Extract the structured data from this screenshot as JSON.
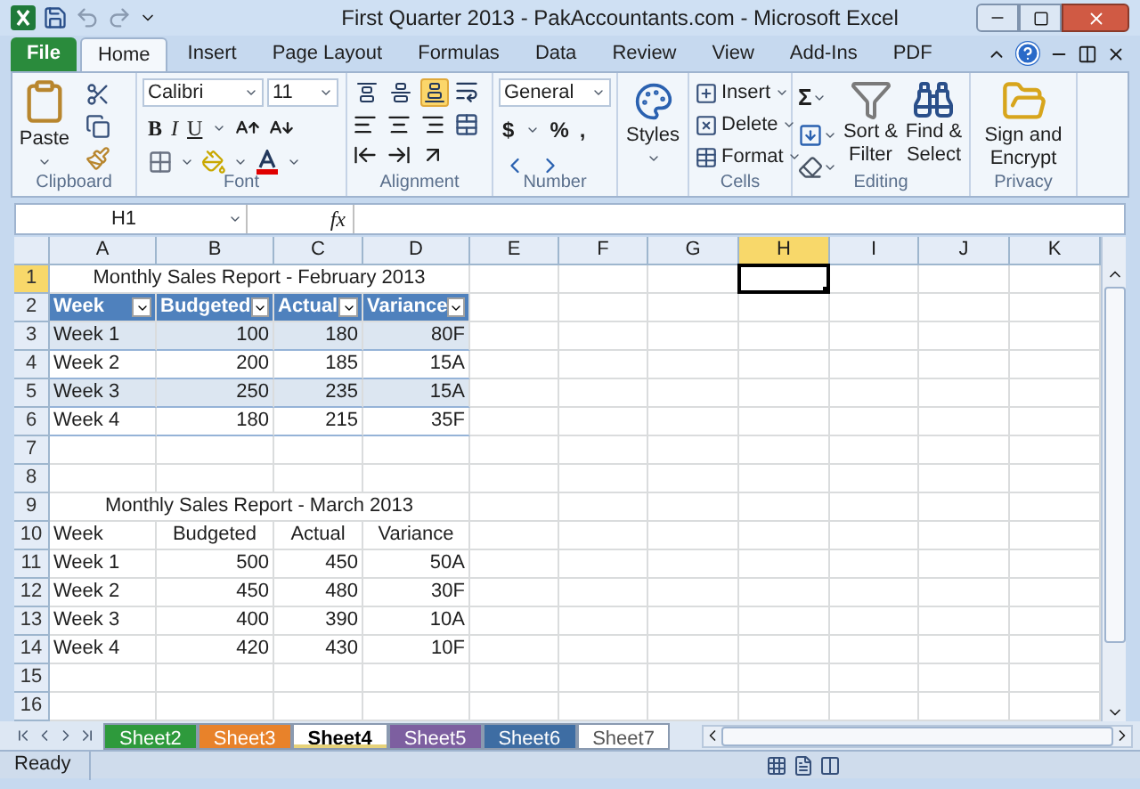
{
  "window": {
    "title": "First Quarter 2013 - PakAccountants.com - Microsoft Excel"
  },
  "menu_tabs": [
    {
      "label": "File",
      "kind": "file",
      "selected": false
    },
    {
      "label": "Home",
      "kind": "tab",
      "selected": true
    },
    {
      "label": "Insert",
      "kind": "tab",
      "selected": false
    },
    {
      "label": "Page Layout",
      "kind": "tab",
      "selected": false
    },
    {
      "label": "Formulas",
      "kind": "tab",
      "selected": false
    },
    {
      "label": "Data",
      "kind": "tab",
      "selected": false
    },
    {
      "label": "Review",
      "kind": "tab",
      "selected": false
    },
    {
      "label": "View",
      "kind": "tab",
      "selected": false
    },
    {
      "label": "Add-Ins",
      "kind": "tab",
      "selected": false
    },
    {
      "label": "PDF",
      "kind": "tab",
      "selected": false
    }
  ],
  "ribbon": {
    "groups": [
      {
        "kind": "clipboard",
        "label": "Clipboard",
        "buttons": [
          "Paste"
        ]
      },
      {
        "kind": "font",
        "label": "Font",
        "font": "Calibri",
        "size": "11",
        "buttons": [
          "B",
          "I",
          "U"
        ]
      },
      {
        "kind": "alignment",
        "label": "Alignment",
        "buttons": [
          {
            "selected": false
          },
          {
            "selected": false
          },
          {
            "selected": true
          }
        ]
      },
      {
        "kind": "number",
        "label": "Number",
        "format": "General",
        "buttons": [
          "$",
          "%",
          ","
        ]
      },
      {
        "kind": "styles",
        "buttons": [
          "Styles"
        ]
      },
      {
        "kind": "cells",
        "label": "Cells",
        "buttons": [
          "Insert",
          "Delete",
          "Format"
        ]
      },
      {
        "kind": "editing",
        "label": "Editing",
        "symbol": "Σ",
        "buttons": [
          "Sort & Filter",
          "Find & Select"
        ]
      },
      {
        "kind": "privacy",
        "label": "Privacy",
        "buttons": [
          "Sign and Encrypt"
        ]
      }
    ]
  },
  "formula_bar": {
    "name_box": "H1",
    "function_label": "fx"
  },
  "columns": [
    {
      "label": "A",
      "selected": false
    },
    {
      "label": "B",
      "selected": false
    },
    {
      "label": "C",
      "selected": false
    },
    {
      "label": "D",
      "selected": false
    },
    {
      "label": "E",
      "selected": false
    },
    {
      "label": "F",
      "selected": false
    },
    {
      "label": "G",
      "selected": false
    },
    {
      "label": "H",
      "selected": true
    },
    {
      "label": "I",
      "selected": false
    },
    {
      "label": "J",
      "selected": false
    },
    {
      "label": "K",
      "selected": false
    }
  ],
  "rows": [
    {
      "number": "1",
      "selected": true,
      "kind": "title",
      "cells": [
        "Monthly Sales Report - February 2013"
      ]
    },
    {
      "number": "2",
      "selected": false,
      "kind": "table_header",
      "cells": [
        "Week",
        "Budgeted",
        "Actual",
        "Variance"
      ]
    },
    {
      "number": "3",
      "selected": false,
      "kind": "table_row",
      "banded": true,
      "cells": [
        "Week 1",
        "100",
        "180",
        "80F"
      ]
    },
    {
      "number": "4",
      "selected": false,
      "kind": "table_row",
      "banded": false,
      "cells": [
        "Week 2",
        "200",
        "185",
        "15A"
      ]
    },
    {
      "number": "5",
      "selected": false,
      "kind": "table_row",
      "banded": true,
      "cells": [
        "Week 3",
        "250",
        "235",
        "15A"
      ]
    },
    {
      "number": "6",
      "selected": false,
      "kind": "table_row",
      "banded": false,
      "cells": [
        "Week 4",
        "180",
        "215",
        "35F"
      ]
    },
    {
      "number": "7",
      "selected": false,
      "kind": "empty"
    },
    {
      "number": "8",
      "selected": false,
      "kind": "empty"
    },
    {
      "number": "9",
      "selected": false,
      "kind": "title",
      "cells": [
        "Monthly Sales Report - March 2013"
      ]
    },
    {
      "number": "10",
      "selected": false,
      "kind": "header",
      "cells": [
        "Week",
        "Budgeted",
        "Actual",
        "Variance"
      ]
    },
    {
      "number": "11",
      "selected": false,
      "kind": "data",
      "cells": [
        "Week 1",
        "500",
        "450",
        "50A"
      ]
    },
    {
      "number": "12",
      "selected": false,
      "kind": "data",
      "cells": [
        "Week 2",
        "450",
        "480",
        "30F"
      ]
    },
    {
      "number": "13",
      "selected": false,
      "kind": "data",
      "cells": [
        "Week 3",
        "400",
        "390",
        "10A"
      ]
    },
    {
      "number": "14",
      "selected": false,
      "kind": "data",
      "cells": [
        "Week 4",
        "420",
        "430",
        "10F"
      ]
    },
    {
      "number": "15",
      "selected": false,
      "kind": "empty"
    },
    {
      "number": "16",
      "selected": false,
      "kind": "empty"
    }
  ],
  "sheet_tabs": [
    {
      "label": "Sheet2",
      "selected": false,
      "color": "#2e9a3c"
    },
    {
      "label": "Sheet3",
      "selected": false,
      "color": "#e8822a"
    },
    {
      "label": "Sheet4",
      "selected": true,
      "color": "#e6d27a"
    },
    {
      "label": "Sheet5",
      "selected": false,
      "color": "#7d5fa0"
    },
    {
      "label": "Sheet6",
      "selected": false,
      "color": "#3e6da3"
    },
    {
      "label": "Sheet7",
      "selected": false
    }
  ],
  "status_bar": {
    "text": "Ready"
  }
}
